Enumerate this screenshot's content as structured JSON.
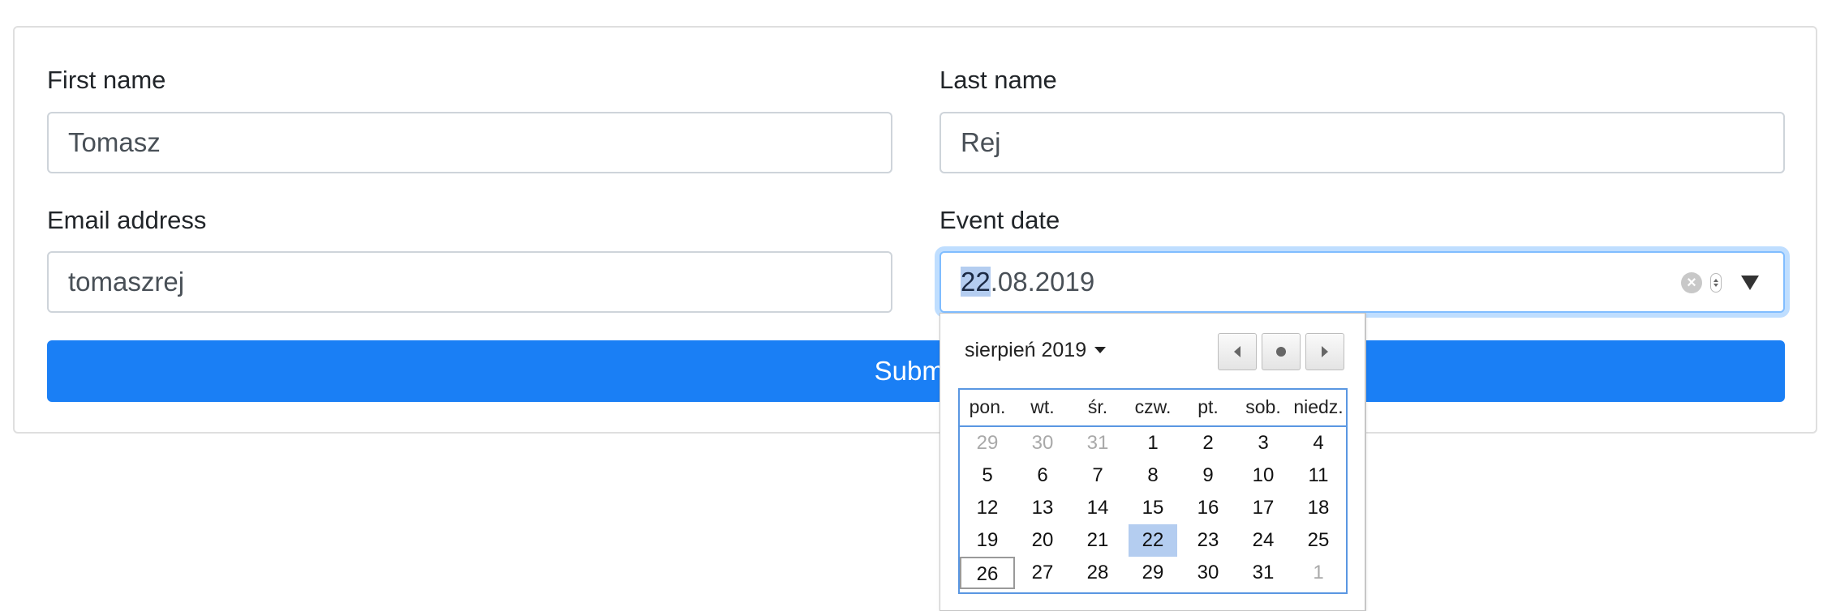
{
  "form": {
    "first_name": {
      "label": "First name",
      "value": "Tomasz"
    },
    "last_name": {
      "label": "Last name",
      "value": "Rej"
    },
    "email": {
      "label": "Email address",
      "value": "tomaszrej"
    },
    "event_date": {
      "label": "Event date",
      "day": "22",
      "rest": ".08.2019"
    },
    "submit_label": "Submit"
  },
  "datepicker": {
    "month_label": "sierpień 2019",
    "weekdays": [
      "pon.",
      "wt.",
      "śr.",
      "czw.",
      "pt.",
      "sob.",
      "niedz."
    ],
    "days": [
      {
        "n": "29",
        "muted": true
      },
      {
        "n": "30",
        "muted": true
      },
      {
        "n": "31",
        "muted": true
      },
      {
        "n": "1"
      },
      {
        "n": "2"
      },
      {
        "n": "3"
      },
      {
        "n": "4"
      },
      {
        "n": "5"
      },
      {
        "n": "6"
      },
      {
        "n": "7"
      },
      {
        "n": "8"
      },
      {
        "n": "9"
      },
      {
        "n": "10"
      },
      {
        "n": "11"
      },
      {
        "n": "12"
      },
      {
        "n": "13"
      },
      {
        "n": "14"
      },
      {
        "n": "15"
      },
      {
        "n": "16"
      },
      {
        "n": "17"
      },
      {
        "n": "18"
      },
      {
        "n": "19"
      },
      {
        "n": "20"
      },
      {
        "n": "21"
      },
      {
        "n": "22",
        "selected": true
      },
      {
        "n": "23"
      },
      {
        "n": "24"
      },
      {
        "n": "25"
      },
      {
        "n": "26",
        "today": true
      },
      {
        "n": "27"
      },
      {
        "n": "28"
      },
      {
        "n": "29"
      },
      {
        "n": "30"
      },
      {
        "n": "31"
      },
      {
        "n": "1",
        "muted": true
      }
    ],
    "colors": {
      "selected": "#b4cdf0",
      "focus_border": "#80bdff",
      "submit": "#1a7ff5"
    }
  }
}
